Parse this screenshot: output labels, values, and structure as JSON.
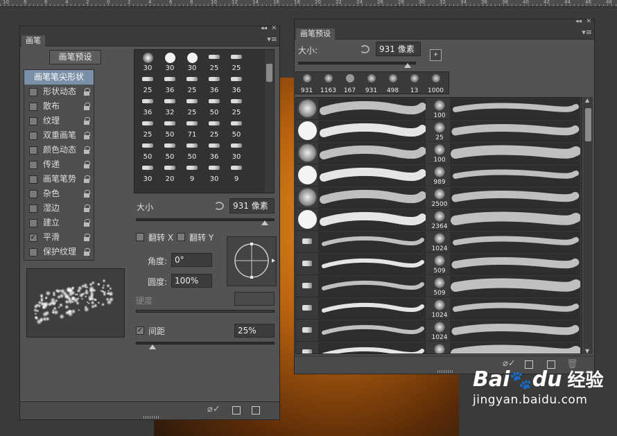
{
  "ruler": {
    "labels": [
      "10",
      "8",
      "6",
      "4",
      "2",
      "0",
      "2",
      "4",
      "6",
      "8",
      "10",
      "12",
      "14",
      "16",
      "18",
      "20",
      "22",
      "24",
      "26",
      "28",
      "30",
      "32",
      "34",
      "36",
      "38",
      "40",
      "42",
      "44",
      "46",
      "48"
    ]
  },
  "brush_panel": {
    "tab": "画笔",
    "preset_button": "画笔预设",
    "options": [
      {
        "label": "画笔笔尖形状",
        "checked": null,
        "selected": true,
        "lock": false
      },
      {
        "label": "形状动态",
        "checked": false,
        "selected": false,
        "lock": true
      },
      {
        "label": "散布",
        "checked": false,
        "selected": false,
        "lock": true
      },
      {
        "label": "纹理",
        "checked": false,
        "selected": false,
        "lock": true
      },
      {
        "label": "双重画笔",
        "checked": false,
        "selected": false,
        "lock": true
      },
      {
        "label": "颜色动态",
        "checked": false,
        "selected": false,
        "lock": true
      },
      {
        "label": "传递",
        "checked": false,
        "selected": false,
        "lock": true
      },
      {
        "label": "画笔笔势",
        "checked": false,
        "selected": false,
        "lock": true
      },
      {
        "label": "杂色",
        "checked": false,
        "selected": false,
        "lock": true
      },
      {
        "label": "湿边",
        "checked": false,
        "selected": false,
        "lock": true
      },
      {
        "label": "建立",
        "checked": false,
        "selected": false,
        "lock": true
      },
      {
        "label": "平滑",
        "checked": true,
        "selected": false,
        "lock": true
      },
      {
        "label": "保护纹理",
        "checked": false,
        "selected": false,
        "lock": true
      }
    ],
    "tip_sizes": [
      "30",
      "30",
      "30",
      "25",
      "25",
      "25",
      "36",
      "25",
      "36",
      "36",
      "36",
      "32",
      "25",
      "50",
      "25",
      "25",
      "50",
      "71",
      "25",
      "50",
      "50",
      "50",
      "50",
      "36",
      "30",
      "30",
      "20",
      "9",
      "30",
      "9"
    ],
    "size_label": "大小",
    "size_value": "931 像素",
    "size_level": 0.93,
    "flip_x": "翻转 X",
    "flip_y": "翻转 Y",
    "angle_label": "角度:",
    "angle_value": "0°",
    "roundness_label": "圆度:",
    "roundness_value": "100%",
    "hardness_label": "硬度",
    "spacing_label": "间距",
    "spacing_checked": true,
    "spacing_value": "25%",
    "spacing_level": 0.12
  },
  "presets_panel": {
    "tab": "画笔预设",
    "size_label": "大小:",
    "size_value": "931 像素",
    "size_level": 0.93,
    "recent_tips": [
      "931",
      "1163",
      "167",
      "931",
      "498",
      "13",
      "1000"
    ],
    "list_sizes": [
      "100",
      "25",
      "100",
      "989",
      "2500",
      "2364",
      "1024",
      "509",
      "509",
      "1024",
      "1024",
      ""
    ]
  },
  "watermark": {
    "logo": "Bai",
    "logo2": "du",
    "brand": "经验",
    "url": "jingyan.baidu.com"
  },
  "colors": {
    "panel": "#535353",
    "accent_select": "#7a8fa8",
    "canvas": "#e28a1e"
  }
}
